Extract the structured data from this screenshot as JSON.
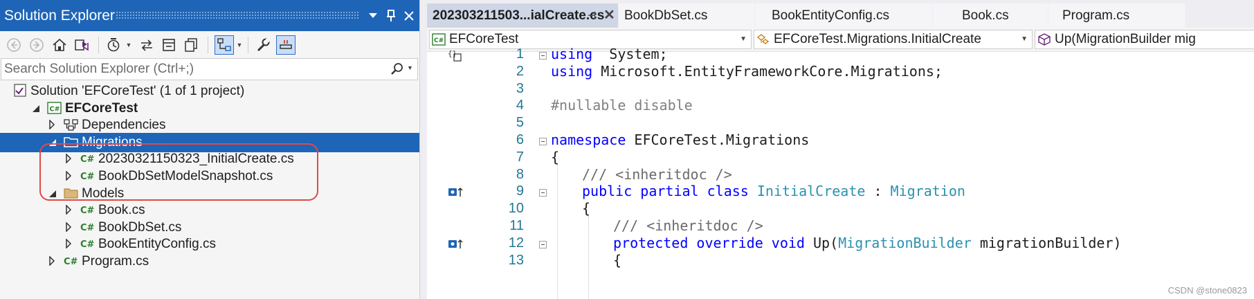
{
  "solution_explorer": {
    "title": "Solution Explorer",
    "search_placeholder": "Search Solution Explorer (Ctrl+;)",
    "tree": [
      {
        "label": "Solution 'EFCoreTest' (1 of 1 project)",
        "icon": "solution-icon",
        "level": 0,
        "expander": "none"
      },
      {
        "label": "EFCoreTest",
        "icon": "csharp-project-icon",
        "level": 1,
        "expander": "expanded",
        "bold": true
      },
      {
        "label": "Dependencies",
        "icon": "dependencies-icon",
        "level": 2,
        "expander": "collapsed"
      },
      {
        "label": "Migrations",
        "icon": "folder-icon",
        "level": 2,
        "expander": "expanded",
        "selected": true
      },
      {
        "label": "20230321150323_InitialCreate.cs",
        "icon": "csharp-file-icon",
        "level": 3,
        "expander": "collapsed"
      },
      {
        "label": "BookDbSetModelSnapshot.cs",
        "icon": "csharp-file-icon",
        "level": 3,
        "expander": "collapsed"
      },
      {
        "label": "Models",
        "icon": "folder-icon",
        "level": 2,
        "expander": "expanded"
      },
      {
        "label": "Book.cs",
        "icon": "csharp-file-icon",
        "level": 3,
        "expander": "collapsed"
      },
      {
        "label": "BookDbSet.cs",
        "icon": "csharp-file-icon",
        "level": 3,
        "expander": "collapsed"
      },
      {
        "label": "BookEntityConfig.cs",
        "icon": "csharp-file-icon",
        "level": 3,
        "expander": "collapsed"
      },
      {
        "label": "Program.cs",
        "icon": "csharp-file-icon",
        "level": 2,
        "expander": "collapsed"
      }
    ]
  },
  "editor": {
    "tabs": [
      {
        "label": "202303211503...ialCreate.cs",
        "active": true
      },
      {
        "label": "BookDbSet.cs",
        "active": false
      },
      {
        "label": "BookEntityConfig.cs",
        "active": false
      },
      {
        "label": "Book.cs",
        "active": false
      },
      {
        "label": "Program.cs",
        "active": false
      }
    ],
    "nav": {
      "project": "EFCoreTest",
      "type": "EFCoreTest.Migrations.InitialCreate",
      "member": "Up(MigrationBuilder mig"
    },
    "lines": [
      {
        "n": "1",
        "fold": true,
        "indent": 0,
        "tokens": [
          [
            "kw",
            "using"
          ],
          [
            "",
            "  System;"
          ]
        ]
      },
      {
        "n": "2",
        "fold": false,
        "indent": 0,
        "tokens": [
          [
            "kw",
            "using"
          ],
          [
            "",
            " Microsoft.EntityFrameworkCore.Migrations;"
          ]
        ]
      },
      {
        "n": "3",
        "fold": false,
        "indent": 0,
        "tokens": []
      },
      {
        "n": "4",
        "fold": false,
        "indent": 0,
        "tokens": [
          [
            "pp",
            "#nullable disable"
          ]
        ]
      },
      {
        "n": "5",
        "fold": false,
        "indent": 0,
        "tokens": []
      },
      {
        "n": "6",
        "fold": true,
        "indent": 0,
        "tokens": [
          [
            "kw",
            "namespace"
          ],
          [
            "",
            " EFCoreTest.Migrations"
          ]
        ]
      },
      {
        "n": "7",
        "fold": false,
        "indent": 0,
        "tokens": [
          [
            "",
            "{"
          ]
        ]
      },
      {
        "n": "8",
        "fold": false,
        "indent": 1,
        "tokens": [
          [
            "cm",
            "/// <inheritdoc />"
          ]
        ]
      },
      {
        "n": "9",
        "fold": true,
        "indent": 1,
        "tokens": [
          [
            "kw",
            "public partial class"
          ],
          [
            "",
            " "
          ],
          [
            "ty",
            "InitialCreate"
          ],
          [
            "",
            " : "
          ],
          [
            "ty",
            "Migration"
          ]
        ]
      },
      {
        "n": "10",
        "fold": false,
        "indent": 1,
        "tokens": [
          [
            "",
            "{"
          ]
        ]
      },
      {
        "n": "11",
        "fold": false,
        "indent": 2,
        "tokens": [
          [
            "cm",
            "/// <inheritdoc />"
          ]
        ]
      },
      {
        "n": "12",
        "fold": true,
        "indent": 2,
        "tokens": [
          [
            "kw",
            "protected override void"
          ],
          [
            "",
            " Up("
          ],
          [
            "ty",
            "MigrationBuilder"
          ],
          [
            "",
            " migrationBuilder)"
          ]
        ]
      },
      {
        "n": "13",
        "fold": false,
        "indent": 2,
        "tokens": [
          [
            "",
            "{"
          ]
        ]
      }
    ],
    "gutter_markers": [
      {
        "line": "1",
        "icon": "code-block-icon"
      },
      {
        "line": "9",
        "icon": "override-arrow-icon"
      },
      {
        "line": "12",
        "icon": "override-arrow-icon"
      }
    ]
  },
  "watermark": "CSDN @stone0823",
  "colors": {
    "accent": "#1e65b7",
    "keyword": "#0000ff",
    "type": "#2b91af",
    "comment": "#6a6a6a",
    "highlight_box": "#e0494b"
  }
}
